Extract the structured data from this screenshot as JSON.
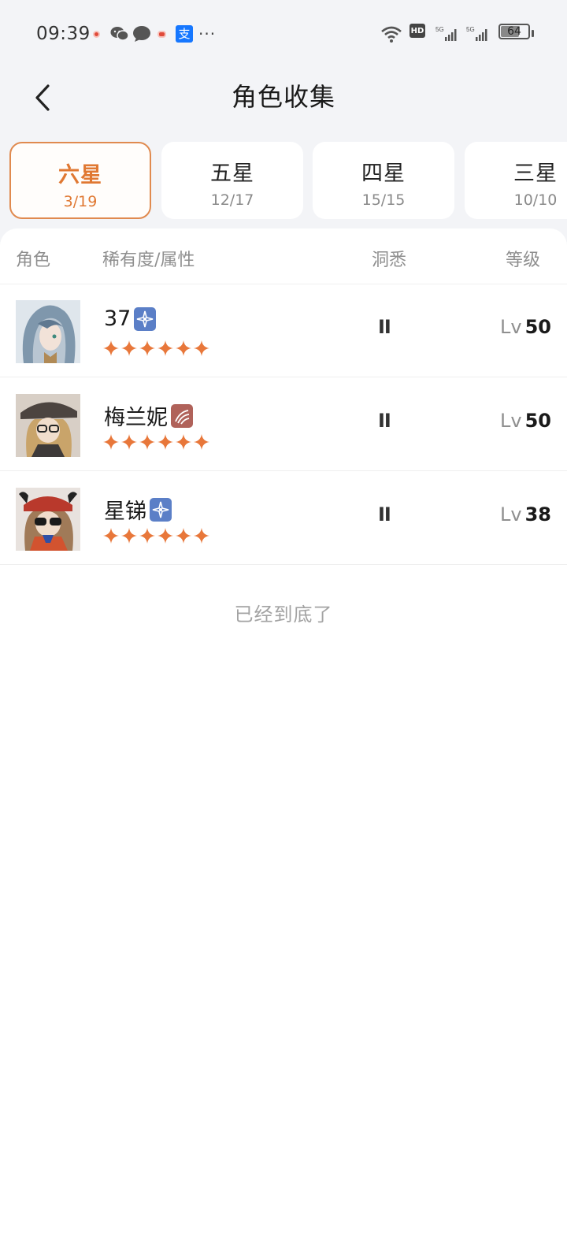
{
  "status_bar": {
    "time": "09:39",
    "more_glyph": "···",
    "alipay_glyph": "支",
    "hd_badge": "HD",
    "battery": "64",
    "battery_level": 0.64
  },
  "header": {
    "title": "角色收集",
    "back_icon": "chevron-left-icon"
  },
  "tabs": [
    {
      "label": "六星",
      "count": "3/19",
      "active": true
    },
    {
      "label": "五星",
      "count": "12/17",
      "active": false
    },
    {
      "label": "四星",
      "count": "15/15",
      "active": false
    },
    {
      "label": "三星",
      "count": "10/10",
      "active": false
    }
  ],
  "columns": {
    "character": "角色",
    "rarity_attr": "稀有度/属性",
    "insight": "洞悉",
    "level": "等级"
  },
  "characters": [
    {
      "name": "37",
      "attribute_icon": "astral-icon",
      "attribute_color": "#5b7fc7",
      "stars": 6,
      "insight": "II",
      "level_prefix": "Lv",
      "level": "50"
    },
    {
      "name": "梅兰妮",
      "attribute_icon": "beast-claw-icon",
      "attribute_color": "#b0625a",
      "stars": 6,
      "insight": "II",
      "level_prefix": "Lv",
      "level": "50"
    },
    {
      "name": "星锑",
      "attribute_icon": "astral-icon",
      "attribute_color": "#5b7fc7",
      "stars": 6,
      "insight": "II",
      "level_prefix": "Lv",
      "level": "38"
    }
  ],
  "end_text": "已经到底了",
  "colors": {
    "accent": "#e07832",
    "star": "#e8773a",
    "background": "#f3f4f7"
  }
}
